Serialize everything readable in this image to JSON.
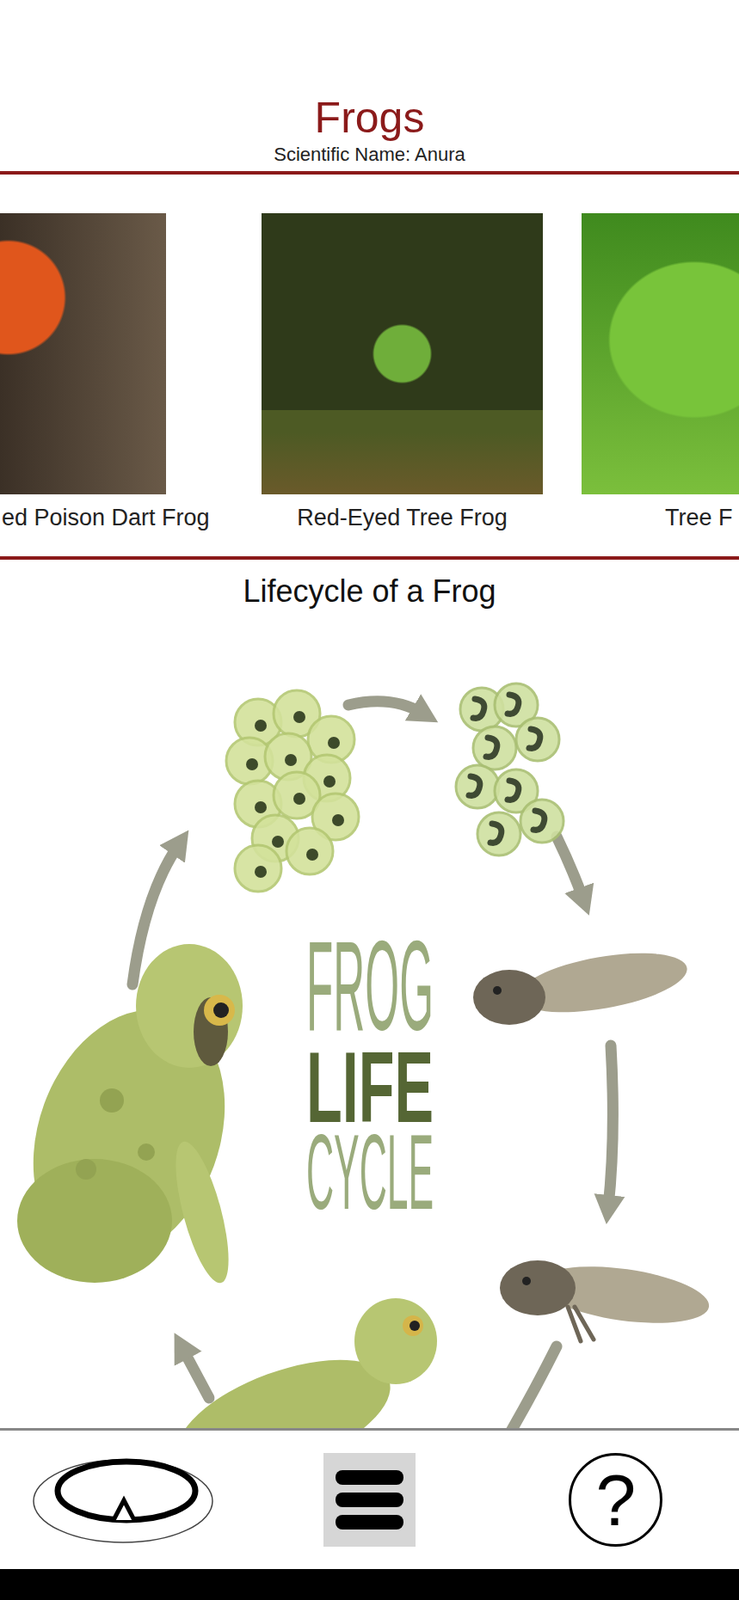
{
  "header": {
    "title": "Frogs",
    "subtitle": "Scientific Name: Anura"
  },
  "gallery": [
    {
      "caption": "ed Poison Dart Frog"
    },
    {
      "caption": "Red-Eyed Tree Frog"
    },
    {
      "caption": "Tree F"
    }
  ],
  "lifecycle": {
    "heading": "Lifecycle of a Frog",
    "title_lines": [
      {
        "text": "FROG",
        "emphasis": false
      },
      {
        "text": "LIFE",
        "emphasis": true
      },
      {
        "text": "CYCLE",
        "emphasis": false
      }
    ]
  },
  "nav": [
    {
      "kind": "logo",
      "selected": false,
      "glyph": ""
    },
    {
      "kind": "menu",
      "selected": true,
      "glyph": ""
    },
    {
      "kind": "help",
      "selected": false,
      "glyph": "?"
    }
  ]
}
